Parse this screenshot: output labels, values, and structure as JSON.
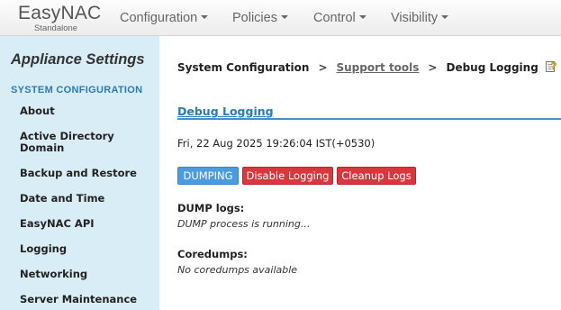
{
  "navbar": {
    "brand_name": "EasyNAC",
    "brand_sub": "Standalone",
    "menus": [
      {
        "label": "Configuration"
      },
      {
        "label": "Policies"
      },
      {
        "label": "Control"
      },
      {
        "label": "Visibility"
      }
    ]
  },
  "sidebar": {
    "title": "Appliance Settings",
    "section": "SYSTEM CONFIGURATION",
    "items": [
      {
        "label": "About"
      },
      {
        "label": "Active Directory\nDomain"
      },
      {
        "label": "Backup and Restore"
      },
      {
        "label": "Date and Time"
      },
      {
        "label": "EasyNAC API"
      },
      {
        "label": "Logging"
      },
      {
        "label": "Networking"
      },
      {
        "label": "Server Maintenance"
      }
    ]
  },
  "breadcrumb": {
    "root": "System Configuration",
    "separator": ">",
    "link": "Support tools",
    "current": "Debug Logging"
  },
  "main": {
    "heading": "Debug Logging",
    "timestamp": "Fri, 22 Aug 2025 19:26:04 IST(+0530)",
    "buttons": {
      "dumping": "DUMPING",
      "disable": "Disable Logging",
      "cleanup": "Cleanup Logs"
    },
    "dump_logs_label": "DUMP logs:",
    "dump_logs_status": "DUMP process is running...",
    "coredumps_label": "Coredumps:",
    "coredumps_status": "No coredumps available"
  },
  "colors": {
    "sidebar_bg": "#d9edf7",
    "accent_blue": "#2a7bb5",
    "button_blue": "#4a9be0",
    "button_red": "#d9363e"
  },
  "icons": {
    "help": "help-icon",
    "caret": "caret-down-icon"
  }
}
